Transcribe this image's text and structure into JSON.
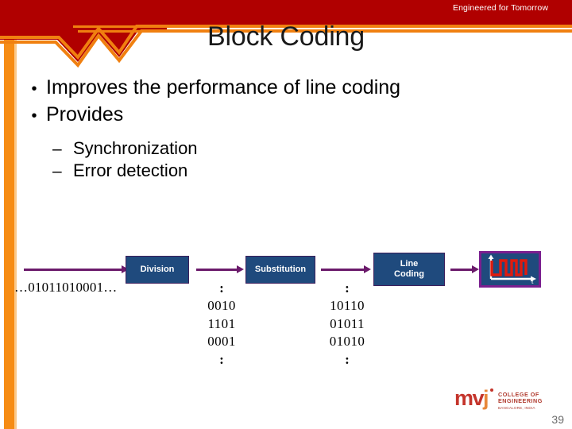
{
  "header": {
    "tagline": "Engineered for Tomorrow",
    "band_color": "#b00000",
    "accent_color": "#f08010"
  },
  "title": "Block Coding",
  "bullets": [
    {
      "marker": "•",
      "text": "Improves the performance of line coding",
      "level": 1
    },
    {
      "marker": "•",
      "text": "Provides",
      "level": 1
    },
    {
      "marker": "–",
      "text": "Synchronization",
      "level": 2
    },
    {
      "marker": "–",
      "text": "Error detection",
      "level": 2
    }
  ],
  "diagram": {
    "input_stream": "…01011010001…",
    "boxes": [
      {
        "label": "Division",
        "lines": [
          "Division"
        ]
      },
      {
        "label": "Substitution",
        "lines": [
          "Substitution"
        ]
      },
      {
        "label": "Line Coding",
        "lines": [
          "Line",
          "Coding"
        ]
      }
    ],
    "datawords": {
      "top_sep": ":",
      "values": [
        "0010",
        "1101",
        "0001"
      ],
      "bottom_sep": ":"
    },
    "codewords": {
      "top_sep": ":",
      "values": [
        "10110",
        "01011",
        "01010"
      ],
      "bottom_sep": ":"
    },
    "waveform": {
      "axis_label": "t",
      "signal_color": "#e01b0e",
      "axis_color": "#ffffff",
      "box_fill": "#1f4a7d",
      "box_border": "#7a1f8f"
    },
    "arrow_color": "#6b1a6b",
    "box_fill": "#1f4a7d",
    "box_border": "#3d1f5c"
  },
  "footer": {
    "logo_mark": "mvj",
    "logo_line1": "COLLEGE OF",
    "logo_line2": "ENGINEERING",
    "logo_line3": "BANGALORE, INDIA",
    "page_number": "39"
  }
}
